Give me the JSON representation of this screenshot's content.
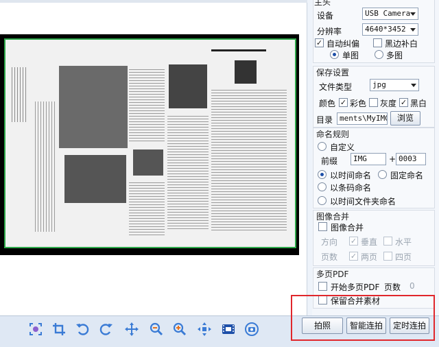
{
  "panel": {
    "group1_title": "主头",
    "device_label": "设备",
    "device_value": "USB Camera",
    "resolution_label": "分辨率",
    "resolution_value": "4640*3452",
    "autocorrect_label": "自动纠偏",
    "blackedge_label": "黑边补白",
    "single_label": "单图",
    "multi_label": "多图",
    "save_title": "保存设置",
    "filetype_label": "文件类型",
    "filetype_value": "jpg",
    "color_label": "颜色",
    "color_opt1": "彩色",
    "color_opt2": "灰度",
    "color_opt3": "黑白",
    "dir_label": "目录",
    "dir_value": "ments\\MyIMG",
    "browse_label": "浏览",
    "naming_title": "命名规则",
    "custom_label": "自定义",
    "prefix_label": "前缀",
    "prefix_value": "IMG",
    "plus_label": "+",
    "counter_value": "0003",
    "time_label": "以时间命名",
    "fixed_label": "固定命名",
    "barcode_label": "以条码命名",
    "timefolder_label": "以时间文件夹命名",
    "merge_title": "图像合并",
    "merge_label": "图像合并",
    "direction_label": "方向",
    "vertical_label": "垂直",
    "horizontal_label": "水平",
    "pages_label": "页数",
    "two_label": "两页",
    "four_label": "四页",
    "pdf_title": "多页PDF",
    "pdf_start_label": "开始多页PDF",
    "pdf_pages_label": "页数",
    "pdf_pages_value": "0",
    "keep_label": "保留合并素材"
  },
  "actions": {
    "capture": "拍照",
    "smart": "智能连拍",
    "timed": "定时连拍"
  },
  "toolbar": [
    "focus-icon",
    "crop-icon",
    "rotate-left-icon",
    "rotate-right-icon",
    "move-icon",
    "zoom-out-icon",
    "zoom-in-icon",
    "fit-icon",
    "film-icon",
    "camera-switch-icon"
  ],
  "colors": {
    "accent": "#3a7bd5",
    "highlight": "#e0262b",
    "crop_border": "#2ea84a"
  }
}
